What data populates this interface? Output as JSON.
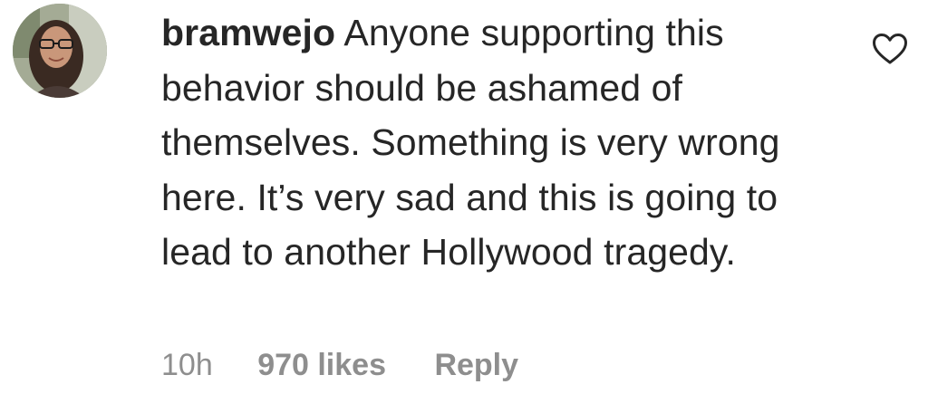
{
  "comment": {
    "username": "bramwejo",
    "text": "Anyone supporting this behavior should be ashamed of themselves. Something is very wrong here. It’s very sad and this is going to lead to another Hollywood tragedy.",
    "time": "10h",
    "likes": "970 likes",
    "reply_label": "Reply",
    "like_icon": "heart-outline-icon"
  },
  "colors": {
    "text": "#262626",
    "meta": "#8e8e8e"
  }
}
